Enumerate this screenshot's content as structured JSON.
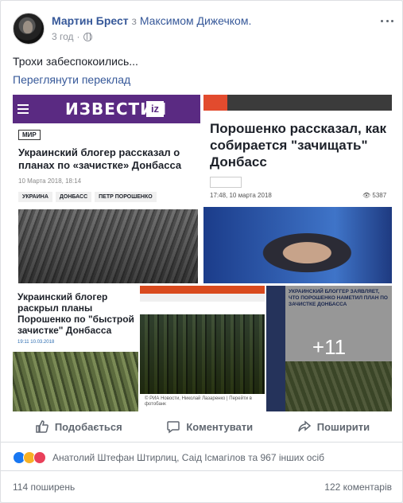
{
  "post": {
    "author": "Мартин Брест",
    "with_word": "з",
    "tagged": "Максимом Дижечком.",
    "time": "3 год",
    "separator": "·",
    "text": "Трохи забеспокоились...",
    "translate": "Переглянути переклад"
  },
  "gallery": {
    "item1": {
      "logo": "ИЗВЕСТИЯ",
      "logo_mark": "iz",
      "tag": "МИР",
      "title": "Украинский блогер рассказал о планах по «зачистке» Донбасса",
      "date": "10 Марта 2018, 18:14",
      "tags": [
        "УКРАИНА",
        "ДОНБАСС",
        "ПЕТР ПОРОШЕНКО"
      ]
    },
    "item2": {
      "title": "Порошенко рассказал, как собирается \"зачищать\" Донбасс",
      "date": "17:48, 10 марта 2018",
      "views": "5387"
    },
    "item3": {
      "title": "Украинский блогер раскрыл планы Порошенко по \"быстрой зачистке\" Донбасса",
      "time": "19:11",
      "date": "10.03.2018"
    },
    "item4": {
      "caption": "© РИА Новости, Николай Лазаренко | Перейти в фотобанк"
    },
    "item5": {
      "headline": "УКРАИНСКИЙ БЛОГГЕР ЗАЯВЛЯЕТ, ЧТО ПОРОШЕНКО НАМЕТИЛ ПЛАН ПО ЗАЧИСТКЕ ДОНБАССА",
      "more_count": "+11"
    }
  },
  "actions": {
    "like": "Подобається",
    "comment": "Коментувати",
    "share": "Поширити"
  },
  "reactions": {
    "text": "Анатолий Штефан Штирлиц, Саід Ісмагілов та 967 інших осіб",
    "icons": [
      "like-icon",
      "haha-icon",
      "love-icon"
    ]
  },
  "stats": {
    "shares": "114 поширень",
    "comments": "122 коментарів"
  },
  "colors": {
    "link": "#365899",
    "meta": "#90949c",
    "izvestia": "#5a2a82"
  }
}
